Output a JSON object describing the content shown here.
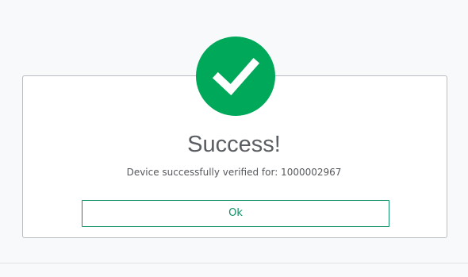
{
  "dialog": {
    "title": "Success!",
    "message": "Device successfully verified for: 1000002967",
    "ok_label": "Ok",
    "icon": "checkmark-icon"
  },
  "colors": {
    "success_green": "#00a85a",
    "button_green": "#0e8f65",
    "title_text": "#5a5d61",
    "body_text": "#55585c",
    "dialog_border": "#b9bcc1",
    "page_background": "#f8f9fb"
  }
}
